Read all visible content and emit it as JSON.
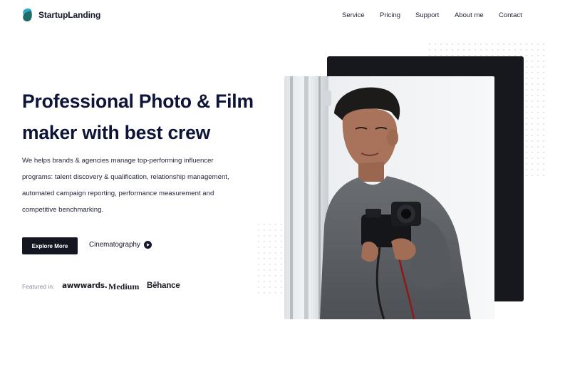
{
  "brand": {
    "name": "StartupLanding",
    "logo_icon": "leaf-logo-icon",
    "logo_colors": [
      "#2b7a78",
      "#3fa7d6"
    ]
  },
  "nav": {
    "items": [
      "Service",
      "Pricing",
      "Support",
      "About me",
      "Contact"
    ]
  },
  "hero": {
    "title_line1": "Professional Photo & Film",
    "title_line2": "maker with best crew",
    "description": [
      "We helps brands & agencies manage top-performing influencer",
      "programs: talent discovery & qualification, relationship management,",
      "automated campaign reporting, performance measurement and",
      "competitive benchmarking."
    ],
    "cta_primary": "Explore More",
    "cta_secondary": "Cinematography",
    "cta_secondary_icon": "play-circle-icon"
  },
  "featured": {
    "label": "Featured in:",
    "brands": [
      "awwwards.",
      "Medium",
      "Bēhance"
    ]
  },
  "colors": {
    "title": "#0e1438",
    "button": "#14171f",
    "card": "#17181d",
    "dots": "#e3e5ea"
  }
}
